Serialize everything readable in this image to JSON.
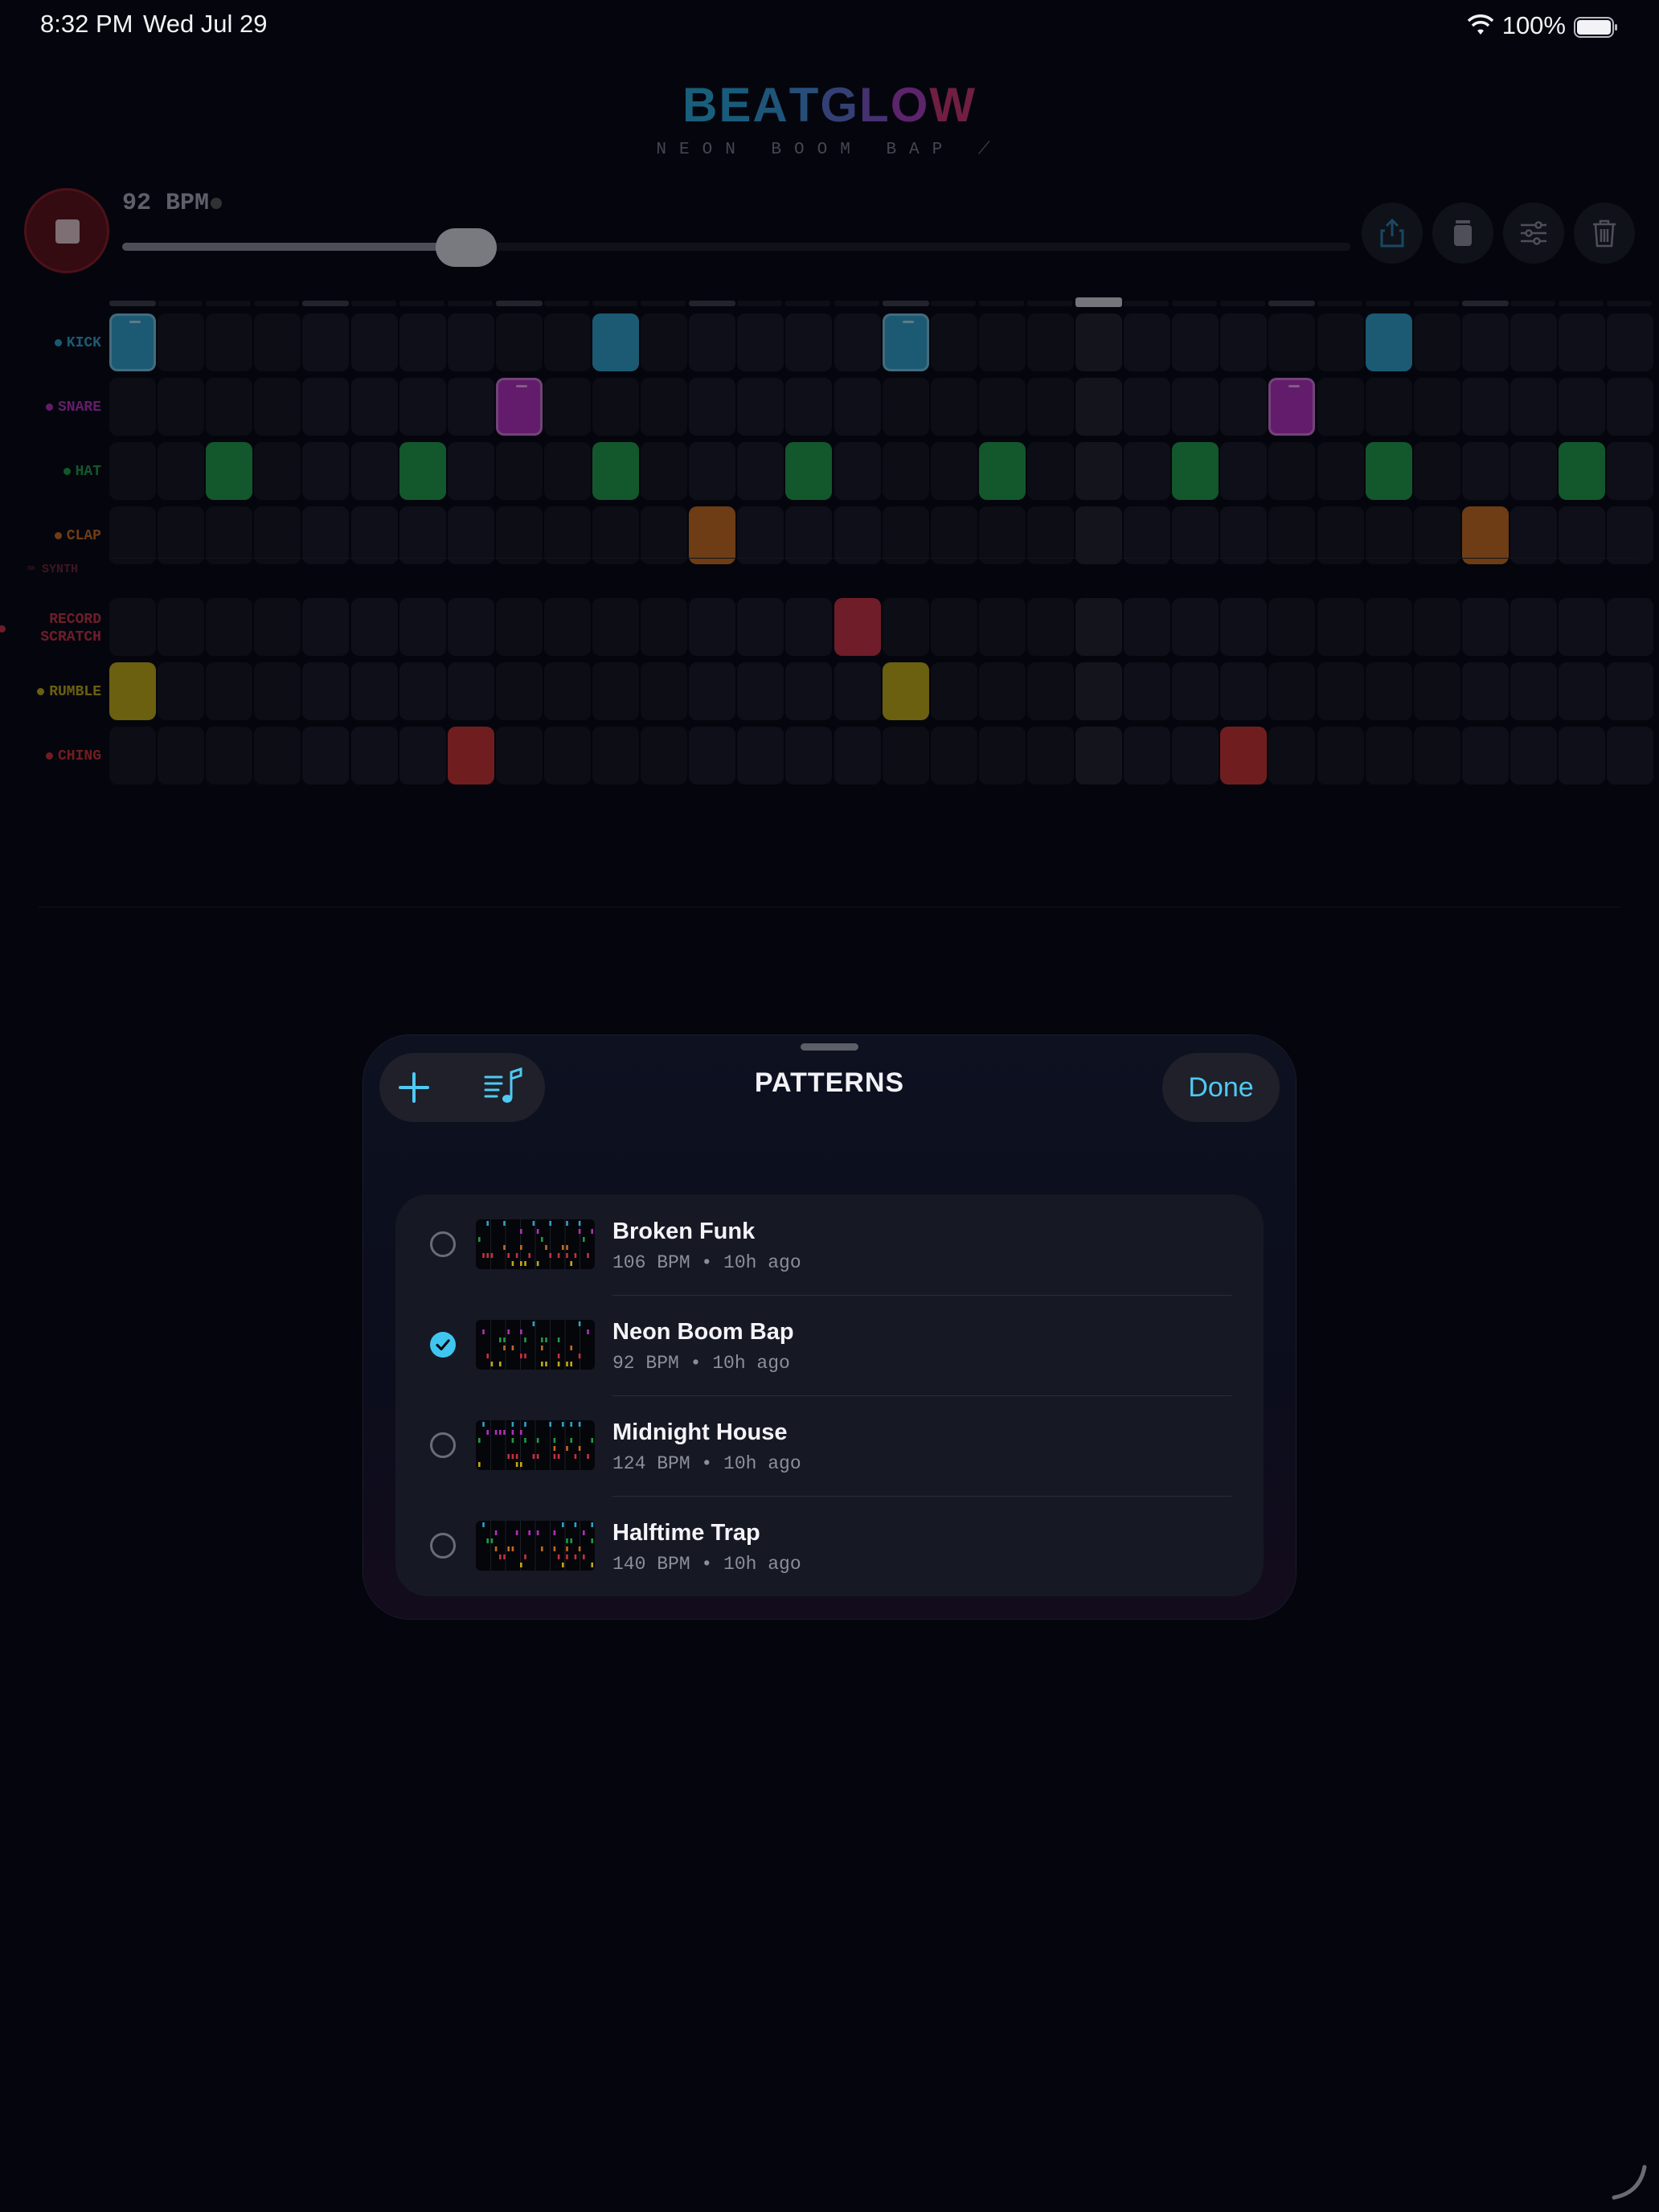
{
  "status_bar": {
    "time": "8:32 PM",
    "date": "Wed Jul 29",
    "battery": "100%"
  },
  "app": {
    "title_letters": [
      {
        "ch": "B",
        "color": "#2aa9d6"
      },
      {
        "ch": "E",
        "color": "#2ba2d4"
      },
      {
        "ch": "A",
        "color": "#3496d2"
      },
      {
        "ch": "T",
        "color": "#418ad0"
      },
      {
        "ch": "G",
        "color": "#5b70c8"
      },
      {
        "ch": "L",
        "color": "#7a55c2"
      },
      {
        "ch": "O",
        "color": "#a43db6"
      },
      {
        "ch": "W",
        "color": "#c9356e"
      }
    ],
    "subtitle": "NEON BOOM BAP ⟋",
    "bpm": "92 BPM",
    "tempo_fraction": 0.28,
    "tools": [
      "share-icon",
      "jar-icon",
      "sliders-icon",
      "trash-icon"
    ]
  },
  "sequencer": {
    "steps": 32,
    "playhead_step": 20,
    "tracks": [
      {
        "label": "KICK",
        "color": "#2fa0c8",
        "active": [
          0,
          10,
          16,
          26
        ]
      },
      {
        "label": "SNARE",
        "color": "#b12fb8",
        "active": [
          8,
          24
        ]
      },
      {
        "label": "HAT",
        "color": "#1f9a46",
        "active": [
          2,
          6,
          10,
          14,
          18,
          22,
          26,
          30
        ]
      },
      {
        "label": "CLAP",
        "color": "#c46a1c",
        "active": [
          12,
          28
        ]
      },
      {
        "label": "SYNTH",
        "color": "#b03848",
        "collapsed": true,
        "active": []
      },
      {
        "label": "RECORD SCRATCH",
        "color": "#c43040",
        "active": [
          15
        ]
      },
      {
        "label": "RUMBLE",
        "color": "#c0a814",
        "active": [
          0,
          16
        ]
      },
      {
        "label": "CHING",
        "color": "#c83030",
        "active": [
          7,
          23
        ]
      }
    ]
  },
  "sheet": {
    "title": "PATTERNS",
    "done_label": "Done",
    "add_icon": "plus-icon",
    "library_icon": "music-list-icon",
    "patterns": [
      {
        "name": "Broken Funk",
        "meta": "106 BPM • 10h ago",
        "selected": false
      },
      {
        "name": "Neon Boom Bap",
        "meta": "92 BPM • 10h ago",
        "selected": true
      },
      {
        "name": "Midnight House",
        "meta": "124 BPM • 10h ago",
        "selected": false
      },
      {
        "name": "Halftime Trap",
        "meta": "140 BPM • 10h ago",
        "selected": false
      }
    ]
  }
}
